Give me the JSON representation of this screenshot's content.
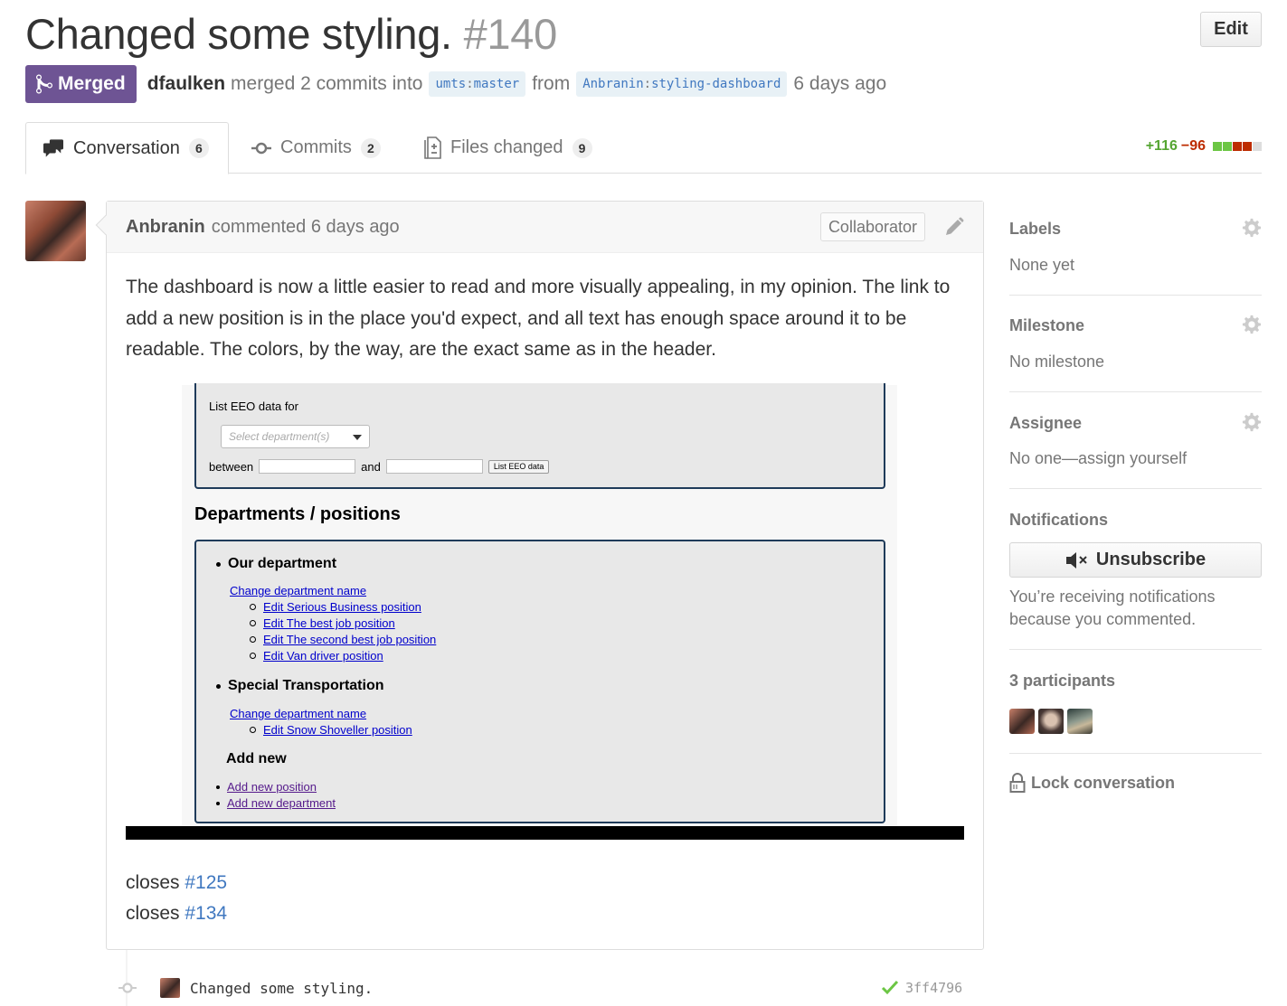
{
  "header": {
    "title": "Changed some styling.",
    "number": "#140",
    "edit_label": "Edit"
  },
  "meta": {
    "state": "Merged",
    "author": "dfaulken",
    "action": "merged 2 commits into",
    "base_owner": "umts",
    "base_branch": "master",
    "from_word": "from",
    "head_owner": "Anbranin",
    "head_branch": "styling-dashboard",
    "time": "6 days ago"
  },
  "tabs": [
    {
      "label": "Conversation",
      "count": "6"
    },
    {
      "label": "Commits",
      "count": "2"
    },
    {
      "label": "Files changed",
      "count": "9"
    }
  ],
  "diffstat": {
    "additions": "+116",
    "deletions": "−96",
    "colors": [
      "#6cc644",
      "#6cc644",
      "#bd2c00",
      "#bd2c00",
      "#ddd"
    ]
  },
  "comment": {
    "author": "Anbranin",
    "action": "commented 6 days ago",
    "badge": "Collaborator",
    "body": "The dashboard is now a little easier to read and more visually appealing, in my opinion. The link to add a new position is in the place you'd expect, and all text has enough space around it to be readable. The colors, by the way, are the exact same as in the header.",
    "closes": [
      {
        "word": "closes",
        "ref": "#125"
      },
      {
        "word": "closes",
        "ref": "#134"
      }
    ]
  },
  "screenshot": {
    "eeo_label": "List EEO data for",
    "select_placeholder": "Select department(s)",
    "between": "between",
    "and": "and",
    "list_button": "List EEO data",
    "dept_title": "Departments / positions",
    "departments": [
      {
        "name": "Our department",
        "change_link": "Change department name",
        "positions": [
          "Edit Serious Business position",
          "Edit The best job position",
          "Edit The second best job position",
          "Edit Van driver position"
        ]
      },
      {
        "name": "Special Transportation",
        "change_link": "Change department name",
        "positions": [
          "Edit Snow Shoveller position"
        ]
      }
    ],
    "add_new_title": "Add new",
    "add_links": [
      "Add new position",
      "Add new department"
    ]
  },
  "sidebar": {
    "labels": {
      "title": "Labels",
      "value": "None yet"
    },
    "milestone": {
      "title": "Milestone",
      "value": "No milestone"
    },
    "assignee": {
      "title": "Assignee",
      "value": "No one—assign yourself"
    },
    "notifications": {
      "title": "Notifications",
      "button": "Unsubscribe",
      "reason": "You’re receiving notifications because you commented."
    },
    "participants": {
      "title": "3 participants"
    },
    "lock": "Lock conversation"
  },
  "commit": {
    "message": "Changed some styling.",
    "sha": "3ff4796",
    "status_color": "#6cc644"
  },
  "icons": [
    "git-merge-icon",
    "comment-discussion-icon",
    "git-commit-icon",
    "diff-icon",
    "pencil-icon",
    "gear-icon",
    "mute-icon",
    "lock-icon",
    "check-icon"
  ]
}
